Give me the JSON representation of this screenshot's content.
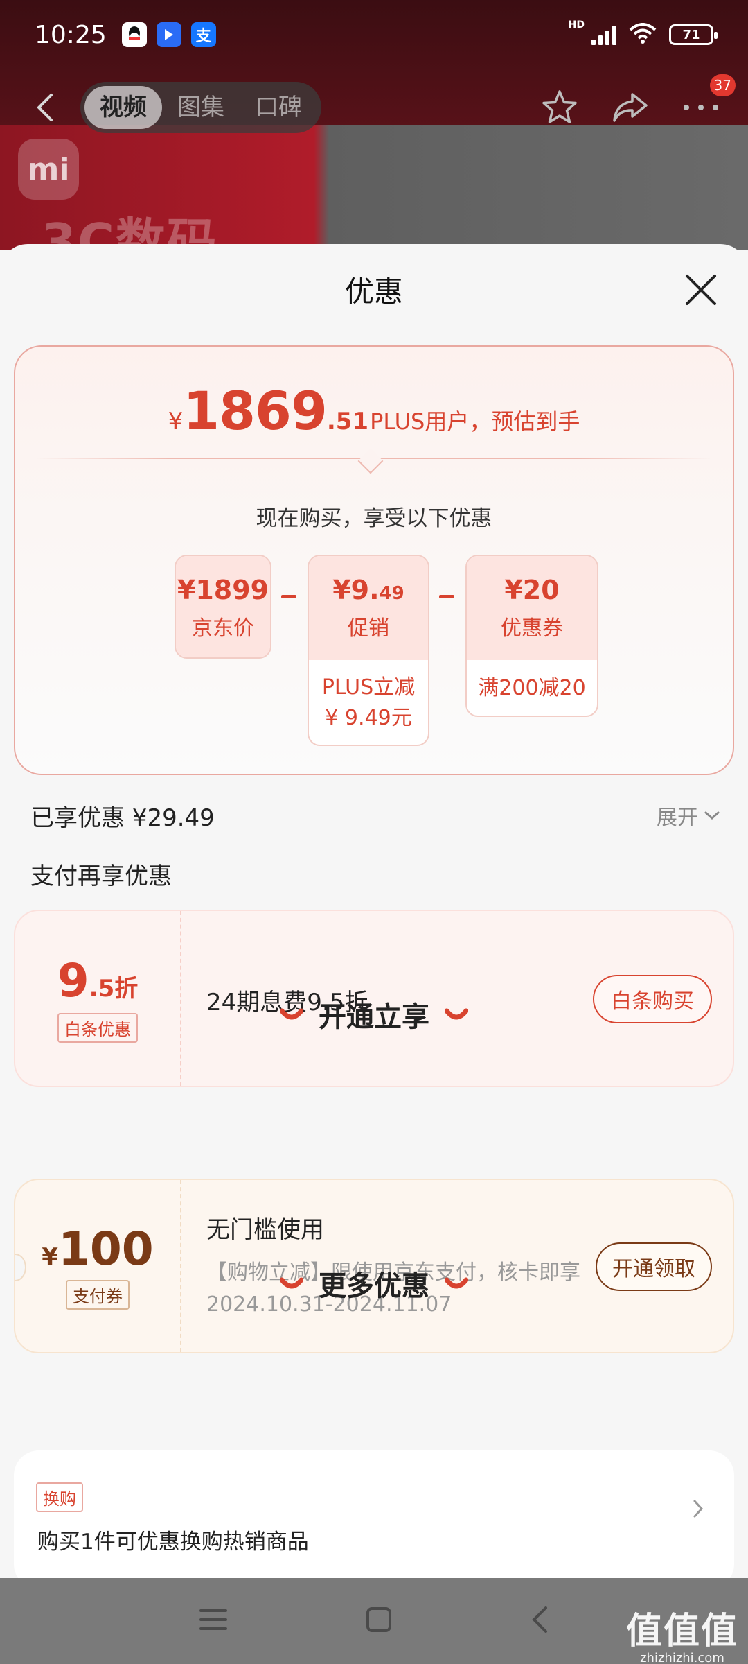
{
  "status_bar": {
    "time": "10:25",
    "hd": "HD",
    "battery": "71",
    "apps": [
      "qq-icon",
      "tiny-app-icon",
      "alipay-icon"
    ],
    "alipay_glyph": "支"
  },
  "background": {
    "logo_text": "mi",
    "banner_text": "3C数码"
  },
  "top_nav": {
    "tabs": [
      {
        "label": "视频",
        "active": true
      },
      {
        "label": "图集",
        "active": false
      },
      {
        "label": "口碑",
        "active": false
      }
    ],
    "more_badge": "37"
  },
  "sheet": {
    "title": "优惠",
    "price_card": {
      "currency": "¥",
      "price_int": "1869",
      "price_dec": ".51",
      "price_note": "PLUS用户，预估到手",
      "enjoy_text": "现在购买，享受以下优惠",
      "items": [
        {
          "amount": "¥1899",
          "label": "京东价"
        },
        {
          "amount": "¥9.",
          "amount_small": "49",
          "label": "促销",
          "detail_line1": "PLUS立减",
          "detail_line2": "¥ 9.49元"
        },
        {
          "amount": "¥20",
          "label": "优惠券",
          "detail_line1": "满200减20"
        }
      ],
      "operators": [
        "-",
        "-"
      ]
    },
    "enjoyed": "已享优惠 ¥29.49",
    "expand_label": "展开",
    "pay_title": "支付再享优惠",
    "baitiao": {
      "rate_big": "9",
      "rate_small": ".5折",
      "tag": "白条优惠",
      "description": "24期息费9.5折",
      "button": "白条购买"
    },
    "section_open": "开通立享",
    "coupon": {
      "currency": "¥",
      "amount": "100",
      "tag": "支付券",
      "title": "无门槛使用",
      "description": "【购物立减】限使用京东支付，核卡即享",
      "date_range": "2024.10.31-2024.11.07",
      "button": "开通领取"
    },
    "section_more": "更多优惠",
    "more": {
      "tag": "换购",
      "text": "购买1件可优惠换购热销商品"
    }
  },
  "watermark": {
    "big": "值值值",
    "small": "zhizhizhi.com"
  },
  "colors": {
    "accent_red": "#d8432f",
    "coupon_brown": "#7a3a16",
    "badge_red": "#e2382f"
  }
}
